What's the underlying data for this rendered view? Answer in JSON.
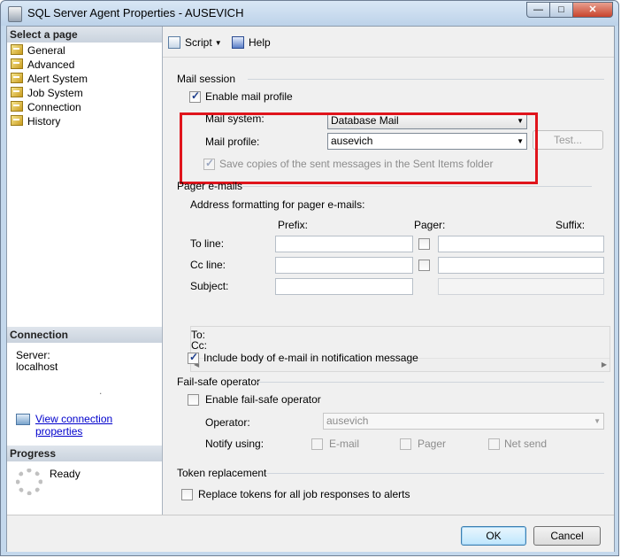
{
  "window": {
    "title": "SQL Server Agent Properties - AUSEVICH",
    "min_glyph": "—",
    "max_glyph": "□",
    "close_glyph": "✕"
  },
  "left_pane": {
    "select_page_header": "Select a page",
    "pages": [
      {
        "label": "General",
        "icon": "page-icon"
      },
      {
        "label": "Advanced",
        "icon": "page-icon"
      },
      {
        "label": "Alert System",
        "icon": "page-icon"
      },
      {
        "label": "Job System",
        "icon": "page-icon"
      },
      {
        "label": "Connection",
        "icon": "page-icon"
      },
      {
        "label": "History",
        "icon": "page-icon"
      }
    ],
    "connection_header": "Connection",
    "server_label": "Server:",
    "server_value": "localhost",
    "dot": ".",
    "view_connection_link": "View connection properties",
    "progress_header": "Progress",
    "progress_status": "Ready"
  },
  "toolbar": {
    "script_label": "Script",
    "help_label": "Help"
  },
  "mail_session": {
    "group_label": "Mail session",
    "enable_mail_profile_label": "Enable mail profile",
    "enable_mail_profile_checked": true,
    "mail_system_label": "Mail system:",
    "mail_system_value": "Database Mail",
    "mail_profile_label": "Mail profile:",
    "mail_profile_value": "ausevich",
    "test_button_label": "Test...",
    "save_copies_label": "Save copies of the sent messages in the Sent Items folder",
    "save_copies_checked": true
  },
  "pager": {
    "group_label": "Pager e-mails",
    "address_formatting_label": "Address formatting for pager e-mails:",
    "prefix_header": "Prefix:",
    "pager_header": "Pager:",
    "suffix_header": "Suffix:",
    "to_line_label": "To line:",
    "cc_line_label": "Cc line:",
    "subject_label": "Subject:",
    "to_label": "To:",
    "cc_label": "Cc:",
    "include_body_label": "Include body of e-mail in notification message",
    "include_body_checked": true
  },
  "fail_safe": {
    "group_label": "Fail-safe operator",
    "enable_label": "Enable fail-safe operator",
    "enable_checked": false,
    "operator_label": "Operator:",
    "operator_value": "ausevich",
    "notify_using_label": "Notify using:",
    "email_label": "E-mail",
    "pager_label": "Pager",
    "net_send_label": "Net send"
  },
  "token": {
    "group_label": "Token replacement",
    "replace_tokens_label": "Replace tokens for all job responses to alerts",
    "replace_tokens_checked": false
  },
  "buttons": {
    "ok_label": "OK",
    "cancel_label": "Cancel"
  },
  "colors": {
    "highlight_border": "#e0141c",
    "link": "#0000cc"
  }
}
